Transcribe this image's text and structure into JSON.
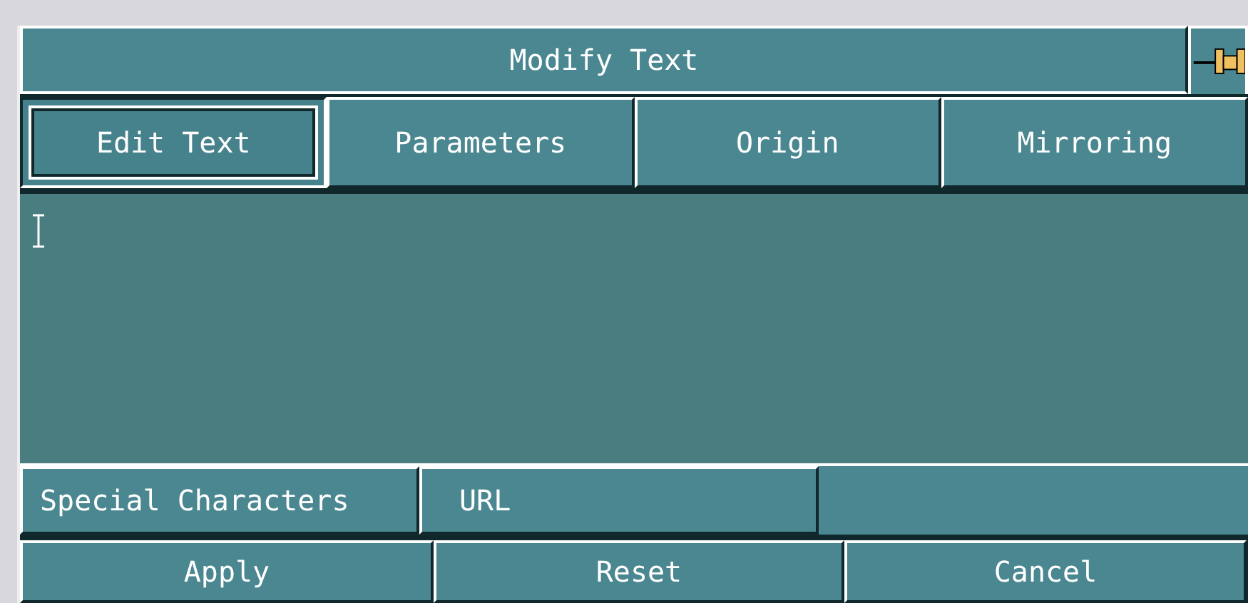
{
  "window": {
    "title": "Modify Text"
  },
  "tabs": [
    {
      "label": "Edit Text",
      "selected": true
    },
    {
      "label": "Parameters",
      "selected": false
    },
    {
      "label": "Origin",
      "selected": false
    },
    {
      "label": "Mirroring",
      "selected": false
    }
  ],
  "text_area": {
    "focused": true
  },
  "insert_buttons": [
    "Special Characters",
    "URL"
  ],
  "buttons": [
    "Apply",
    "Reset",
    "Cancel"
  ]
}
